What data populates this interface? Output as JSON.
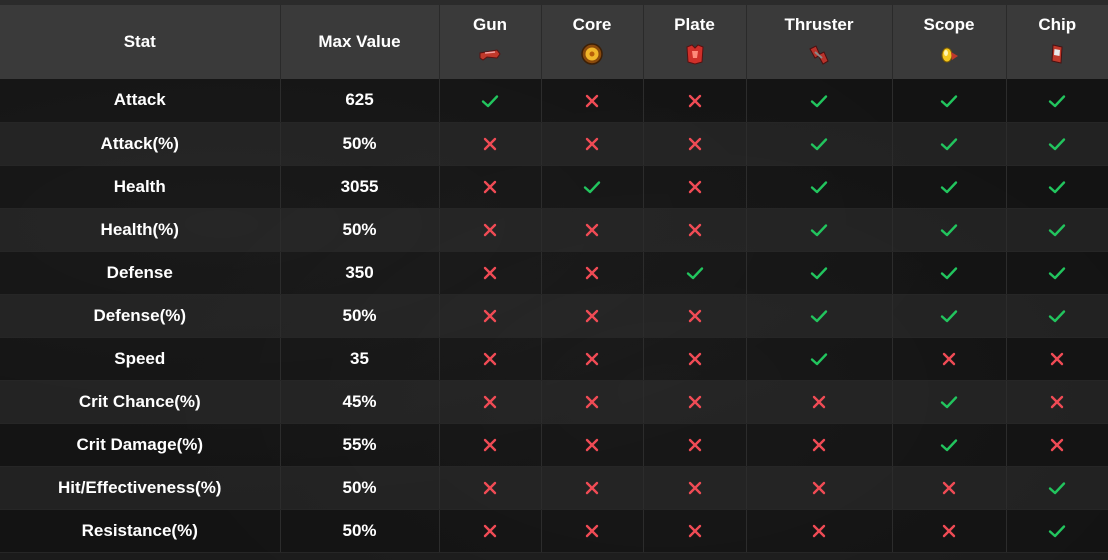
{
  "table": {
    "headers": {
      "stat": "Stat",
      "max_value": "Max Value",
      "equipment": [
        {
          "label": "Gun",
          "icon": "gun-icon"
        },
        {
          "label": "Core",
          "icon": "core-icon"
        },
        {
          "label": "Plate",
          "icon": "plate-icon"
        },
        {
          "label": "Thruster",
          "icon": "thruster-icon"
        },
        {
          "label": "Scope",
          "icon": "scope-icon"
        },
        {
          "label": "Chip",
          "icon": "chip-icon"
        }
      ]
    },
    "rows": [
      {
        "stat": "Attack",
        "max": "625",
        "marks": [
          true,
          false,
          false,
          true,
          true,
          true
        ]
      },
      {
        "stat": "Attack(%)",
        "max": "50%",
        "marks": [
          false,
          false,
          false,
          true,
          true,
          true
        ]
      },
      {
        "stat": "Health",
        "max": "3055",
        "marks": [
          false,
          true,
          false,
          true,
          true,
          true
        ]
      },
      {
        "stat": "Health(%)",
        "max": "50%",
        "marks": [
          false,
          false,
          false,
          true,
          true,
          true
        ]
      },
      {
        "stat": "Defense",
        "max": "350",
        "marks": [
          false,
          false,
          true,
          true,
          true,
          true
        ]
      },
      {
        "stat": "Defense(%)",
        "max": "50%",
        "marks": [
          false,
          false,
          false,
          true,
          true,
          true
        ]
      },
      {
        "stat": "Speed",
        "max": "35",
        "marks": [
          false,
          false,
          false,
          true,
          false,
          false
        ]
      },
      {
        "stat": "Crit Chance(%)",
        "max": "45%",
        "marks": [
          false,
          false,
          false,
          false,
          true,
          false
        ]
      },
      {
        "stat": "Crit Damage(%)",
        "max": "55%",
        "marks": [
          false,
          false,
          false,
          false,
          true,
          false
        ]
      },
      {
        "stat": "Hit/Effectiveness(%)",
        "max": "50%",
        "marks": [
          false,
          false,
          false,
          false,
          false,
          true
        ]
      },
      {
        "stat": "Resistance(%)",
        "max": "50%",
        "marks": [
          false,
          false,
          false,
          false,
          false,
          true
        ]
      }
    ]
  },
  "colors": {
    "check": "#22c55e",
    "cross": "#f04b55",
    "header_bg": "#3a3a3a"
  }
}
